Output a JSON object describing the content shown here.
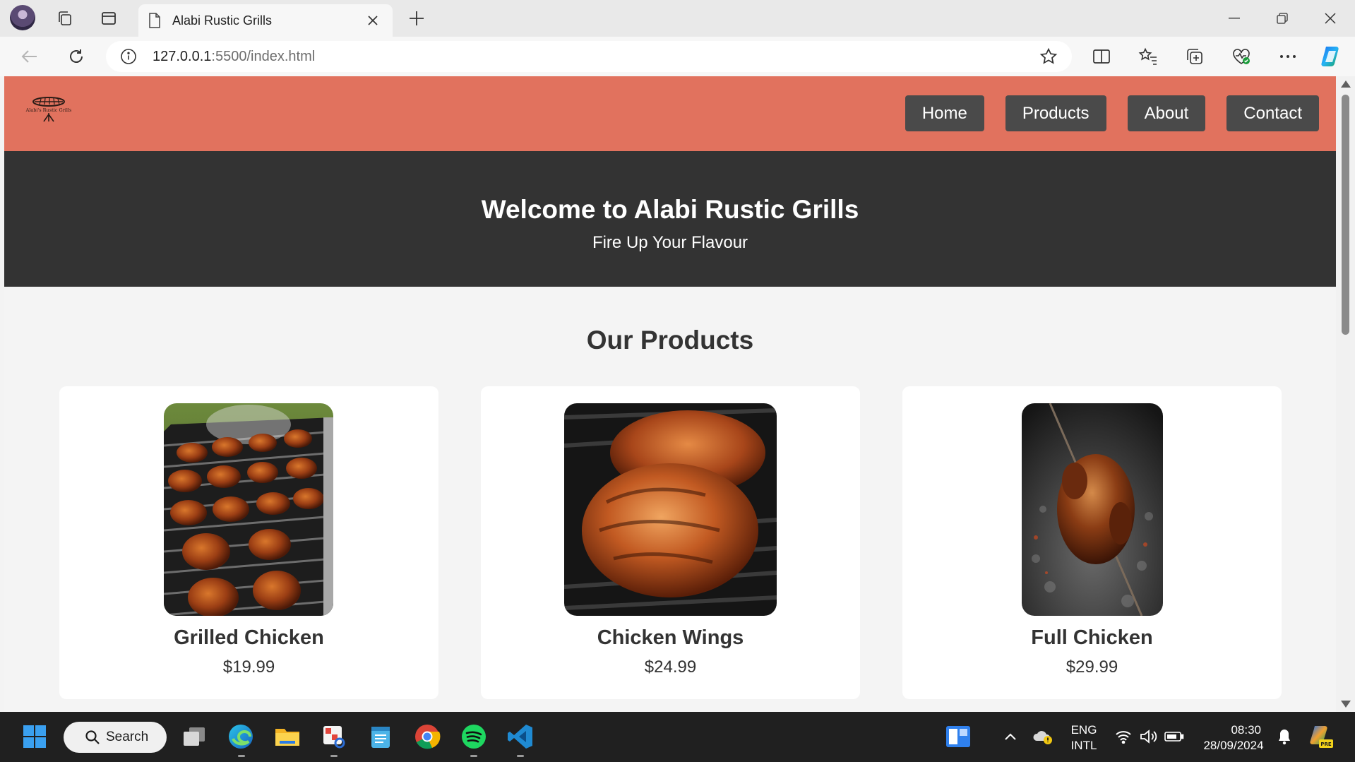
{
  "browser": {
    "tab_title": "Alabi Rustic Grills",
    "url_host": "127.0.0.1",
    "url_path": ":5500/index.html"
  },
  "site": {
    "logo_text": "Alabi's Rustic Grills",
    "nav": [
      "Home",
      "Products",
      "About",
      "Contact"
    ],
    "hero_title": "Welcome to Alabi Rustic Grills",
    "hero_subtitle": "Fire Up Your Flavour",
    "products_title": "Our Products",
    "products": [
      {
        "name": "Grilled Chicken",
        "price": "$19.99"
      },
      {
        "name": "Chicken Wings",
        "price": "$24.99"
      },
      {
        "name": "Full Chicken",
        "price": "$29.99"
      }
    ],
    "colors": {
      "header": "#e1725e",
      "hero": "#333333",
      "nav_button": "#4a4a4a"
    }
  },
  "taskbar": {
    "search_label": "Search",
    "lang_line1": "ENG",
    "lang_line2": "INTL",
    "time": "08:30",
    "date": "28/09/2024"
  }
}
